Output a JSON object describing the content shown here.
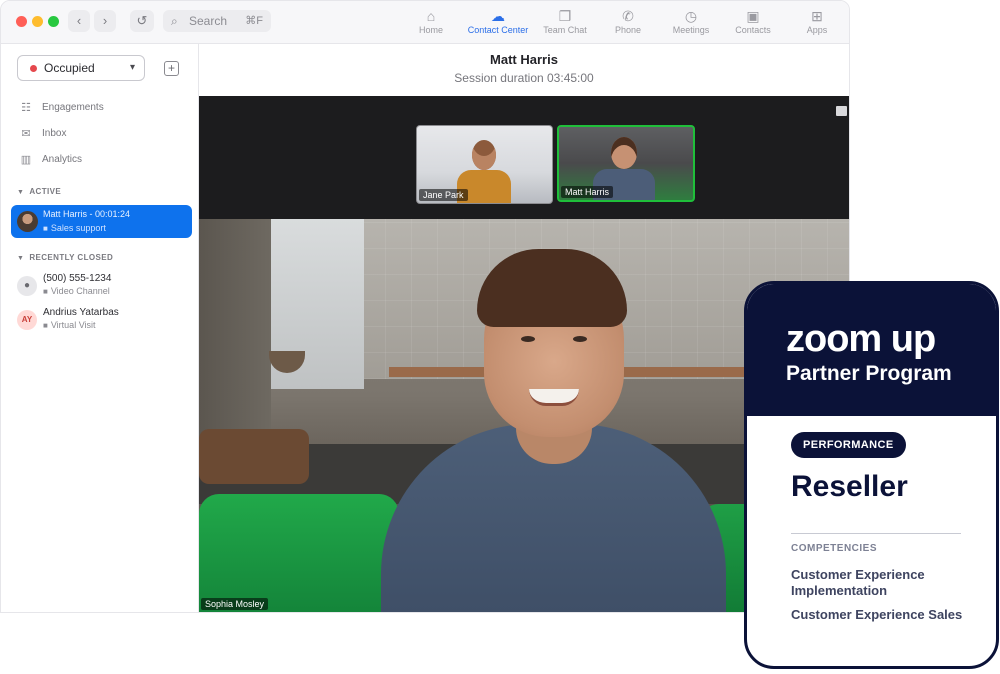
{
  "search": {
    "placeholder": "Search",
    "shortcut": "⌘F"
  },
  "tabs": [
    {
      "label": "Home",
      "icon": "home-icon",
      "active": false
    },
    {
      "label": "Contact Center",
      "icon": "contact-center-icon",
      "active": true
    },
    {
      "label": "Team Chat",
      "icon": "team-chat-icon",
      "active": false
    },
    {
      "label": "Phone",
      "icon": "phone-icon",
      "active": false
    },
    {
      "label": "Meetings",
      "icon": "meetings-icon",
      "active": false
    },
    {
      "label": "Contacts",
      "icon": "contacts-icon",
      "active": false
    },
    {
      "label": "Apps",
      "icon": "apps-icon",
      "active": false
    }
  ],
  "sidebar": {
    "status": "Occupied",
    "status_color": "#e5484d",
    "menu": [
      {
        "label": "Engagements",
        "icon": "engagements-icon"
      },
      {
        "label": "Inbox",
        "icon": "inbox-icon"
      },
      {
        "label": "Analytics",
        "icon": "analytics-icon"
      }
    ],
    "active_section": "ACTIVE",
    "active_item": {
      "name": "Matt Harris",
      "timer": "00:01:24",
      "channel": "Sales support"
    },
    "closed_section": "RECENTLY CLOSED",
    "closed_items": [
      {
        "title": "(500) 555-1234",
        "channel": "Video Channel",
        "avatar": ""
      },
      {
        "title": "Andrius Yatarbas",
        "channel": "Virtual Visit",
        "avatar": "AY"
      }
    ]
  },
  "session": {
    "title": "Matt Harris",
    "duration_label": "Session duration 03:45:00"
  },
  "video": {
    "participants": [
      {
        "name": "Jane Park"
      },
      {
        "name": "Matt Harris"
      }
    ],
    "speaker": "Sophia Mosley"
  },
  "badge": {
    "logo_line1": "zoom up",
    "logo_line2": "Partner Program",
    "category": "PERFORMANCE",
    "tier": "Reseller",
    "competencies_label": "COMPETENCIES",
    "competencies": [
      "Customer Experience Implementation",
      "Customer Experience Sales"
    ]
  },
  "colors": {
    "accent": "#0e72ed",
    "tab_active": "#2c6fe8",
    "badge_navy": "#0b1238",
    "active_speaker": "#1fbf3a"
  }
}
